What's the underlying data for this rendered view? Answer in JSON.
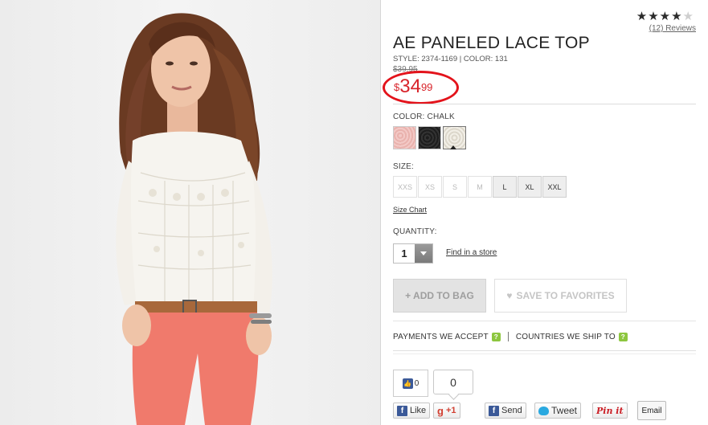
{
  "product": {
    "title": "AE PANELED LACE TOP",
    "style_line": "STYLE: 2374-1169 | COLOR: 131",
    "old_price": "$39.95",
    "price_symbol": "$",
    "price_dollars": "34",
    "price_cents": "99",
    "rating_stars": 4,
    "reviews_label": "(12) Reviews"
  },
  "color": {
    "label": "COLOR: CHALK",
    "swatches": [
      "pink",
      "black",
      "chalk"
    ],
    "selected": "chalk"
  },
  "size": {
    "label": "SIZE:",
    "options": [
      "XXS",
      "XS",
      "S",
      "M",
      "L",
      "XL",
      "XXL"
    ],
    "available": [
      "L",
      "XL",
      "XXL"
    ],
    "chart_link": "Size Chart"
  },
  "quantity": {
    "label": "QUANTITY:",
    "value": "1",
    "find_store": "Find in a store"
  },
  "actions": {
    "add_to_bag": "+ ADD TO BAG",
    "save_favorites": "SAVE TO FAVORITES"
  },
  "info_links": {
    "payments": "PAYMENTS WE ACCEPT",
    "countries": "COUNTRIES WE SHIP TO",
    "help_icon": "?"
  },
  "social": {
    "like_count": "0",
    "share_count": "0",
    "like_label": "Like",
    "plus_label": "+1",
    "send_label": "Send",
    "tweet_label": "Tweet",
    "pinit_label": "Pin it",
    "email_label": "Email",
    "fb_glyph": "f",
    "google_glyph": "g",
    "like_glyph": "👍"
  },
  "colors": {
    "price_red": "#d8232a",
    "help_green": "#8dc63f",
    "facebook_blue": "#3b5998",
    "twitter_blue": "#2aa9e0",
    "pinterest_red": "#cb2027"
  }
}
